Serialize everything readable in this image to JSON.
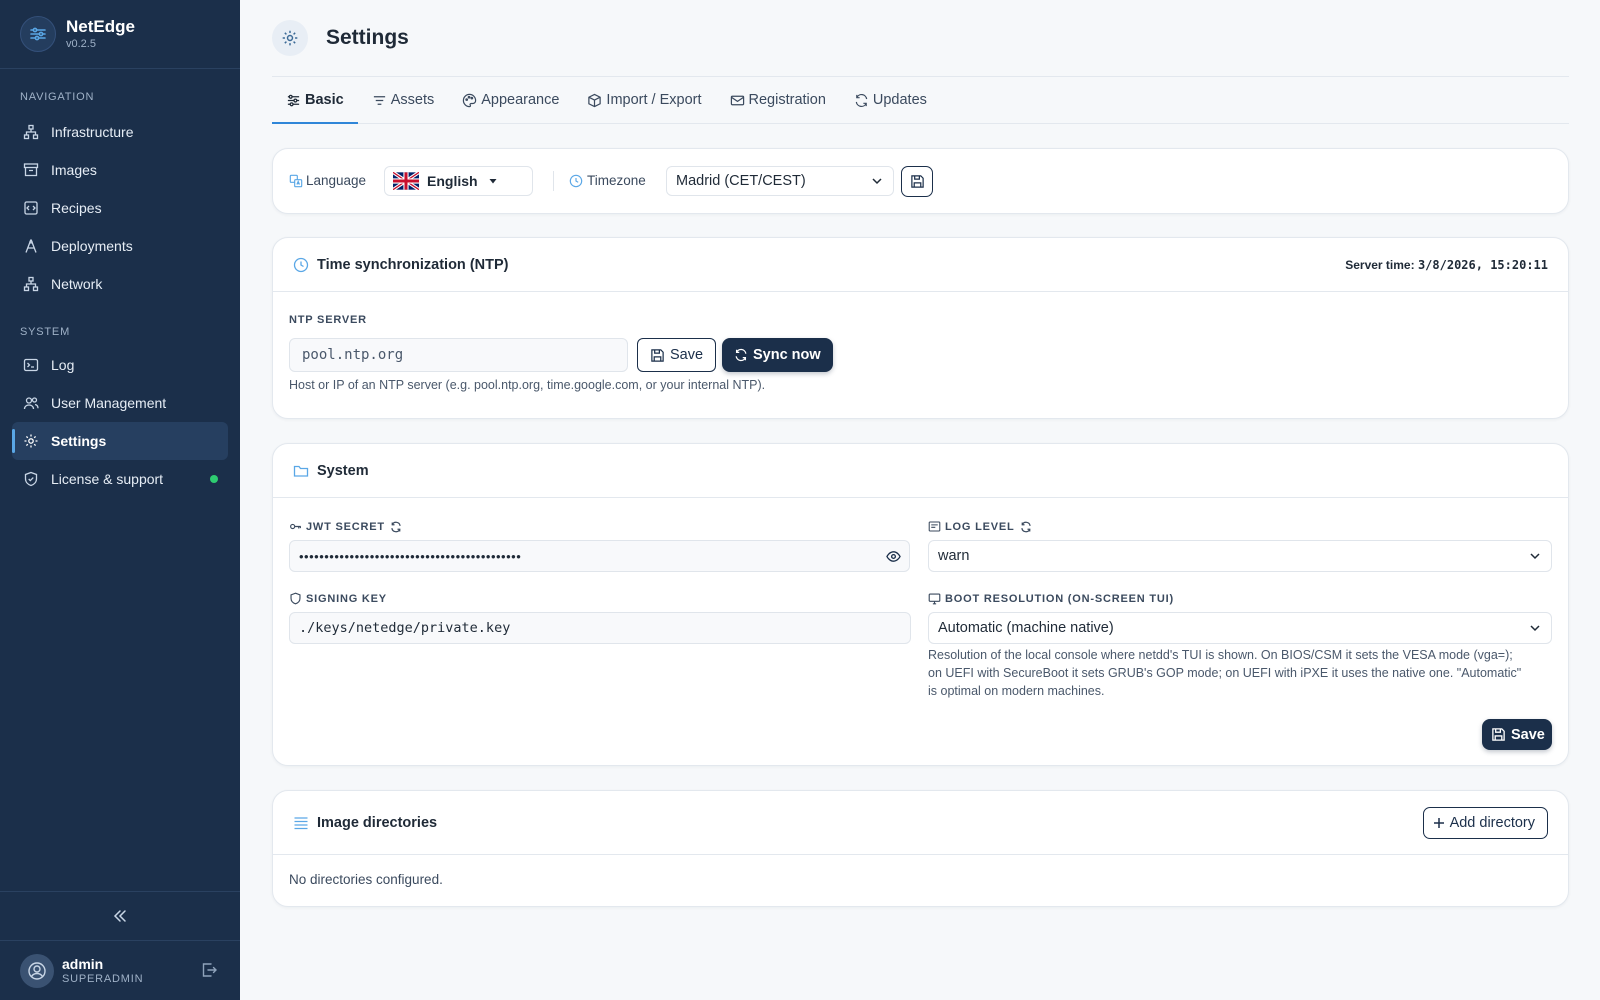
{
  "brand": {
    "name": "NetEdge",
    "version": "v0.2.5"
  },
  "sidebar": {
    "navigation_label": "NAVIGATION",
    "system_label": "SYSTEM",
    "nav_items": [
      {
        "label": "Infrastructure",
        "icon": "infrastructure-icon"
      },
      {
        "label": "Images",
        "icon": "images-icon"
      },
      {
        "label": "Recipes",
        "icon": "recipes-icon"
      },
      {
        "label": "Deployments",
        "icon": "deployments-icon"
      },
      {
        "label": "Network",
        "icon": "network-icon"
      }
    ],
    "system_items": [
      {
        "label": "Log",
        "icon": "terminal-icon"
      },
      {
        "label": "User Management",
        "icon": "users-icon"
      },
      {
        "label": "Settings",
        "icon": "gear-icon",
        "active": true
      },
      {
        "label": "License & support",
        "icon": "shield-icon",
        "status_color": "#2ecc71"
      }
    ]
  },
  "user": {
    "name": "admin",
    "role": "SUPERADMIN"
  },
  "page": {
    "title": "Settings"
  },
  "tabs": [
    {
      "label": "Basic",
      "active": true
    },
    {
      "label": "Assets"
    },
    {
      "label": "Appearance"
    },
    {
      "label": "Import / Export"
    },
    {
      "label": "Registration"
    },
    {
      "label": "Updates"
    }
  ],
  "locale": {
    "language_label": "Language",
    "language_value": "English",
    "timezone_label": "Timezone",
    "timezone_value": "Madrid (CET/CEST)"
  },
  "ntp": {
    "title": "Time synchronization (NTP)",
    "server_time_label": "Server time:",
    "server_time_value": "3/8/2026, 15:20:11",
    "server_label": "NTP SERVER",
    "server_value": "pool.ntp.org",
    "save_label": "Save",
    "sync_label": "Sync now",
    "help": "Host or IP of an NTP server (e.g. pool.ntp.org, time.google.com, or your internal NTP)."
  },
  "system": {
    "title": "System",
    "jwt_label": "JWT SECRET",
    "jwt_value": "••••••••••••••••••••••••••••••••••••••••••••",
    "log_level_label": "LOG LEVEL",
    "log_level_value": "warn",
    "signing_key_label": "SIGNING KEY",
    "signing_key_value": "./keys/netedge/private.key",
    "boot_res_label": "BOOT RESOLUTION (ON-SCREEN TUI)",
    "boot_res_value": "Automatic (machine native)",
    "boot_res_help_1": "Resolution of the local console where netdd's TUI is shown. On BIOS/CSM it sets the VESA mode (vga=);",
    "boot_res_help_2": "on UEFI with SecureBoot it sets GRUB's GOP mode; on UEFI with iPXE it uses the native one. \"Automatic\"",
    "boot_res_help_3": "is optimal on modern machines.",
    "save_label": "Save"
  },
  "image_dirs": {
    "title": "Image directories",
    "add_label": "Add directory",
    "empty_text": "No directories configured."
  },
  "colors": {
    "sidebar_bg": "#1b2f4a",
    "accent": "#2f86d8",
    "status_ok": "#2ecc71"
  }
}
